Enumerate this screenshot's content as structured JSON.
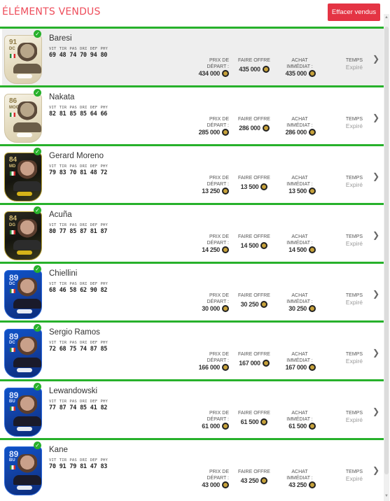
{
  "header": {
    "title": "ÉLÉMENTS VENDUS",
    "clear_label": "Effacer vendus"
  },
  "columns": {
    "start": [
      "PRIX DE",
      "DÉPART :"
    ],
    "offer": "FAIRE OFFRE",
    "buy": [
      "ACHAT",
      "IMMÉDIAT :"
    ],
    "time": "TEMPS"
  },
  "stat_labels": [
    "VIT",
    "TIR",
    "PAS",
    "DRI",
    "DEF",
    "PHY"
  ],
  "items": [
    {
      "name": "Baresi",
      "rating": "91",
      "position": "DC",
      "card": "icon",
      "stats": [
        "69",
        "48",
        "74",
        "70",
        "94",
        "80"
      ],
      "start_price": "434 000",
      "offer": "435 000",
      "buy_now": "435 000",
      "time": "Expiré"
    },
    {
      "name": "Nakata",
      "rating": "86",
      "position": "MOC",
      "card": "icon",
      "stats": [
        "82",
        "81",
        "85",
        "85",
        "64",
        "66"
      ],
      "start_price": "285 000",
      "offer": "286 000",
      "buy_now": "286 000",
      "time": "Expiré"
    },
    {
      "name": "Gerard Moreno",
      "rating": "84",
      "position": "MD",
      "card": "gold",
      "stats": [
        "79",
        "83",
        "70",
        "81",
        "48",
        "72"
      ],
      "start_price": "13 250",
      "offer": "13 500",
      "buy_now": "13 500",
      "time": "Expiré"
    },
    {
      "name": "Acuña",
      "rating": "84",
      "position": "DG",
      "card": "gold",
      "stats": [
        "80",
        "77",
        "85",
        "87",
        "81",
        "87"
      ],
      "start_price": "14 250",
      "offer": "14 500",
      "buy_now": "14 500",
      "time": "Expiré"
    },
    {
      "name": "Chiellini",
      "rating": "89",
      "position": "DC",
      "card": "blue",
      "stats": [
        "68",
        "46",
        "58",
        "62",
        "90",
        "82"
      ],
      "start_price": "30 000",
      "offer": "30 250",
      "buy_now": "30 250",
      "time": "Expiré"
    },
    {
      "name": "Sergio Ramos",
      "rating": "89",
      "position": "DC",
      "card": "blue",
      "stats": [
        "72",
        "68",
        "75",
        "74",
        "87",
        "85"
      ],
      "start_price": "166 000",
      "offer": "167 000",
      "buy_now": "167 000",
      "time": "Expiré"
    },
    {
      "name": "Lewandowski",
      "rating": "89",
      "position": "BU",
      "card": "blue",
      "stats": [
        "77",
        "87",
        "74",
        "85",
        "41",
        "82"
      ],
      "start_price": "61 000",
      "offer": "61 500",
      "buy_now": "61 500",
      "time": "Expiré"
    },
    {
      "name": "Kane",
      "rating": "89",
      "position": "BU",
      "card": "blue",
      "stats": [
        "70",
        "91",
        "79",
        "81",
        "47",
        "83"
      ],
      "start_price": "43 000",
      "offer": "43 250",
      "buy_now": "43 250",
      "time": "Expiré"
    }
  ]
}
